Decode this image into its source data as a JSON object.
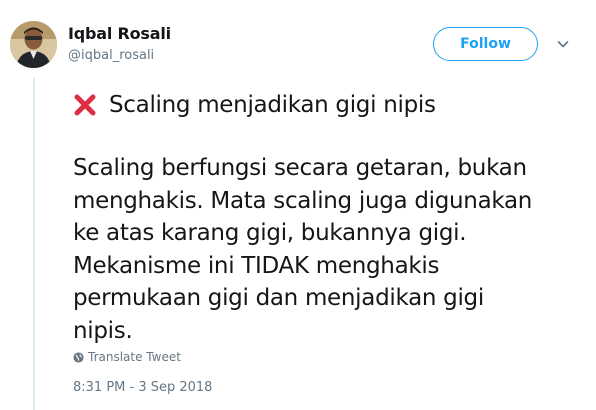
{
  "author": {
    "name": "Iqbal Rosali",
    "handle": "@iqbal_rosali",
    "avatar_icon": "user-avatar"
  },
  "actions": {
    "follow_label": "Follow",
    "menu_icon": "chevron-down-icon"
  },
  "tweet": {
    "headline_icon": "cross-mark-icon",
    "headline": "Scaling menjadikan gigi nipis",
    "body_lines": [
      "Scaling berfungsi secara getaran, bukan",
      "menghakis. Mata scaling juga digunakan",
      "ke atas karang gigi, bukannya gigi.",
      "Mekanisme ini TIDAK menghakis",
      "permukaan gigi dan menjadikan gigi",
      "nipis."
    ],
    "translate_label": "Translate Tweet",
    "timestamp": "8:31 PM - 3 Sep 2018"
  },
  "colors": {
    "accent": "#1da1f2",
    "secondary_text": "#657786",
    "cross_mark": "#dd2e44",
    "thread_line": "#dde9f3"
  }
}
